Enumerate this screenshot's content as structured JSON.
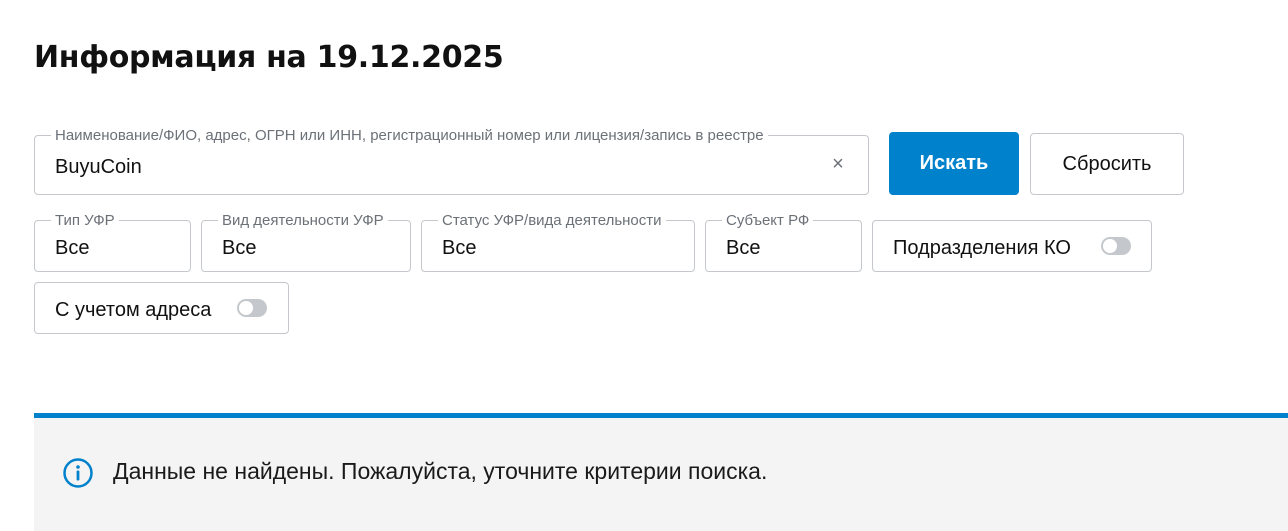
{
  "page": {
    "title": "Информация на 19.12.2025"
  },
  "search": {
    "legend": "Наименование/ФИО, адрес, ОГРН или ИНН, регистрационный номер или лицензия/запись в реестре",
    "value": "BuyuCoin",
    "clear_glyph": "×"
  },
  "buttons": {
    "search_label": "Искать",
    "reset_label": "Сбросить"
  },
  "filters": [
    {
      "legend": "Тип УФР",
      "value": "Все"
    },
    {
      "legend": "Вид деятельности УФР",
      "value": "Все"
    },
    {
      "legend": "Статус УФР/вида деятельности",
      "value": "Все"
    },
    {
      "legend": "Субъект РФ",
      "value": "Все"
    }
  ],
  "toggles": {
    "ko_label": "Подразделения КО",
    "ko_on": false,
    "address_label": "С учетом адреса",
    "address_on": false
  },
  "alert": {
    "icon": "info-icon",
    "message": "Данные не найдены. Пожалуйста, уточните критерии поиска."
  },
  "colors": {
    "accent": "#0081cc",
    "border": "#c4c8cc",
    "alert_bg": "#f4f4f5"
  }
}
